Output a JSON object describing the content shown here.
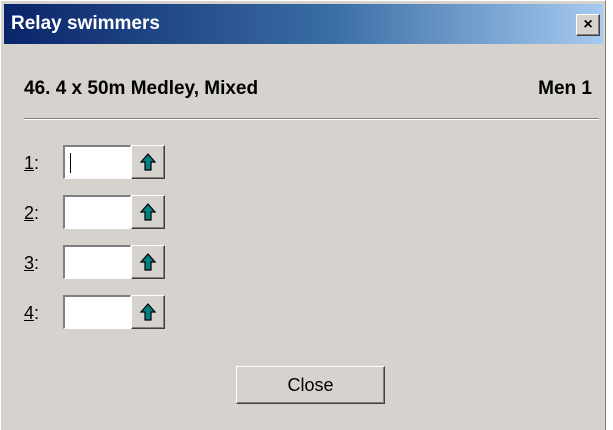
{
  "window": {
    "title": "Relay swimmers",
    "close_glyph": "×"
  },
  "header": {
    "event": "46. 4 x 50m Medley, Mixed",
    "team": "Men 1"
  },
  "swimmers": [
    {
      "mnemonic": "1",
      "suffix": ":",
      "value": "",
      "button_icon": "up-arrow-icon"
    },
    {
      "mnemonic": "2",
      "suffix": ":",
      "value": "",
      "button_icon": "up-arrow-icon"
    },
    {
      "mnemonic": "3",
      "suffix": ":",
      "value": "",
      "button_icon": "up-arrow-icon"
    },
    {
      "mnemonic": "4",
      "suffix": ":",
      "value": "",
      "button_icon": "up-arrow-icon"
    }
  ],
  "footer": {
    "close_label": "Close"
  },
  "colors": {
    "dialog_bg": "#d6d3ce",
    "title_start": "#0a246a",
    "title_end": "#a6caf0",
    "arrow": "#008080"
  }
}
